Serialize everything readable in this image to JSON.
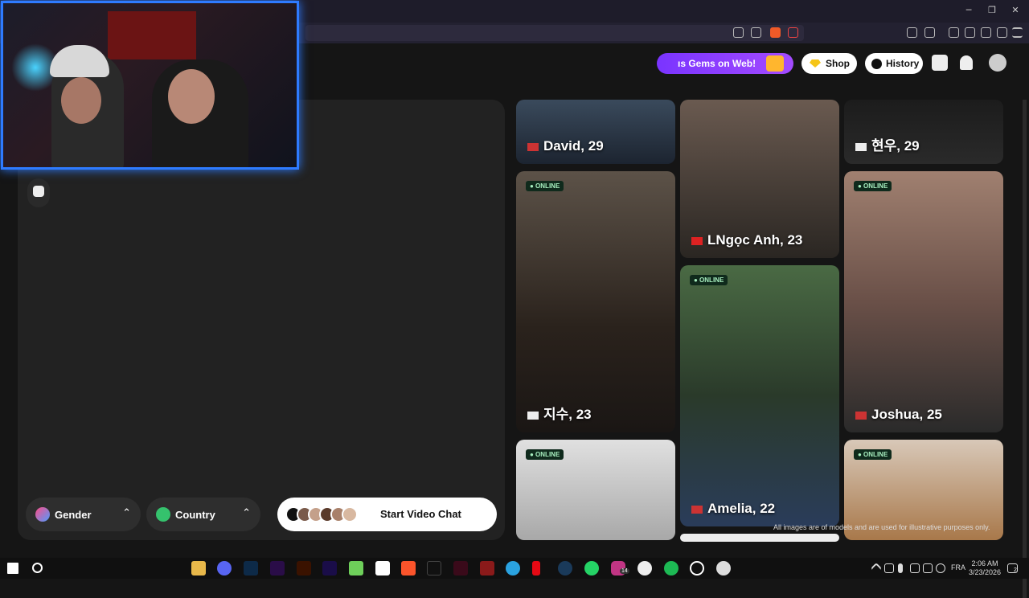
{
  "window": {
    "minimize": "─",
    "restore": "❐",
    "close": "✕"
  },
  "header": {
    "gems_label": "ıs Gems on Web!",
    "shop_label": "Shop",
    "history_label": "History"
  },
  "filters": {
    "gender_label": "Gender",
    "country_label": "Country",
    "start_label": "Start Video Chat"
  },
  "cards": [
    {
      "name": "David, 29",
      "online": false
    },
    {
      "name": "LNgọc Anh, 23",
      "online": false
    },
    {
      "name": "현우, 29",
      "online": false
    },
    {
      "name": "지수, 23",
      "online": true
    },
    {
      "name": "Amelia, 22",
      "online": true
    },
    {
      "name": "Joshua, 25",
      "online": true
    },
    {
      "name": "",
      "online": true
    },
    {
      "name": "",
      "online": true
    }
  ],
  "online_label": "● ONLINE",
  "disclaimer": "All images are of models and are used for illustrative purposes only.",
  "taskbar": {
    "lang": "FRA",
    "time": "2:06 AM",
    "date": "3/23/2026",
    "ig_badge": "14",
    "notif_badge": "2"
  },
  "colors": {
    "accent": "#8a3dff",
    "webcam_border": "#2e7bff",
    "online_bg": "#0f2a1c"
  }
}
